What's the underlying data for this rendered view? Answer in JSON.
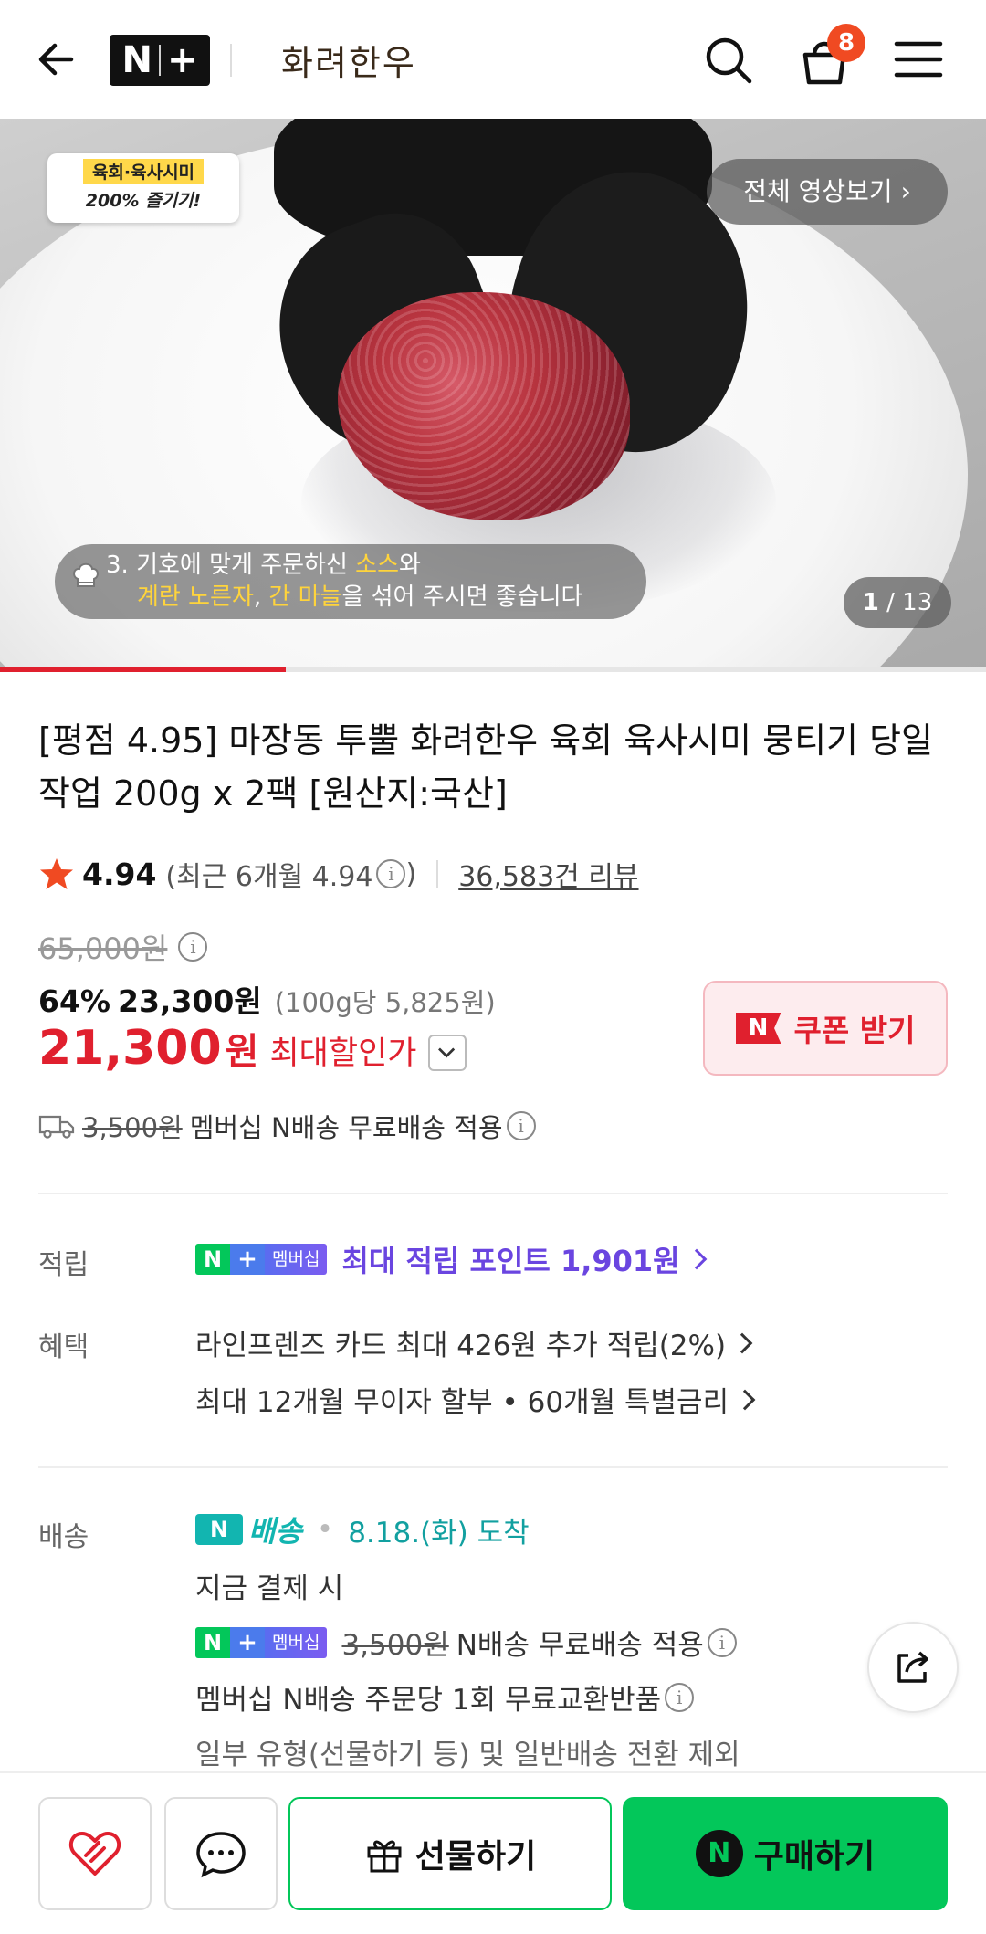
{
  "header": {
    "logo_text": "N",
    "logo_plus": "+",
    "store_name": "화려한우",
    "cart_count": "8"
  },
  "media": {
    "tag_line1": "육회·육사시미",
    "tag_line2": "200% 즐기기!",
    "full_video_label": "전체 영상보기",
    "caption_line1_prefix": "3. 기호에 맞게 주문하신 ",
    "caption_line1_highlight": "소스",
    "caption_line1_suffix": "와",
    "caption_line2_highlight1": "계란 노른자",
    "caption_line2_comma": ", ",
    "caption_line2_highlight2": "간 마늘",
    "caption_line2_suffix": "을 섞어 주시면 좋습니다",
    "counter_current": "1",
    "counter_total": "/ 13",
    "progress_fraction": 0.29
  },
  "product": {
    "title": "[평점 4.95] 마장동 투뿔 화려한우 육회 육사시미 뭉티기 당일작업 200g x 2팩 [원산지:국산]",
    "rating": "4.94",
    "recent_rating_text": "(최근 6개월 4.94",
    "recent_rating_close": ")",
    "review_count": "36,583건 리뷰",
    "original_price": "65,000원",
    "discount_percent": "64%",
    "discount_price": "23,300원",
    "unit_price": "(100g당 5,825원)",
    "final_price": "21,300",
    "final_currency": "원",
    "final_label": "최대할인가",
    "coupon_label": "쿠폰 받기",
    "coupon_n": "N",
    "shipping_fee": "3,500원",
    "shipping_text": "멤버십 N배송 무료배송 적용"
  },
  "benefits": {
    "points_label": "적립",
    "membership_badge": "멤버십",
    "points_text": "최대 적립 포인트 1,901원",
    "benefit_label": "혜택",
    "benefit_1": "라인프렌즈 카드 최대 426원 추가 적립(2%)",
    "benefit_2": "최대 12개월 무이자 할부 • 60개월 특별금리"
  },
  "delivery": {
    "label": "배송",
    "service_name": "배송",
    "date": "8.18.(화) 도착",
    "condition": "지금 결제 시",
    "fee": "3,500원",
    "fee_text": "N배송 무료배송 적용",
    "exchange_text": "멤버십 N배송 주문당 1회 무료교환반품",
    "exclusion_text": "일부 유형(선물하기 등) 및 일반배송 전환 제외"
  },
  "bottom_bar": {
    "gift_label": "선물하기",
    "buy_label": "구매하기",
    "buy_n": "N"
  },
  "colors": {
    "accent_red": "#e0202e",
    "naver_green": "#03c75a",
    "point_purple": "#6a45e0",
    "delivery_teal": "#12b5b0"
  },
  "icons": [
    "back-arrow-icon",
    "search-icon",
    "cart-icon",
    "menu-icon",
    "chef-hat-icon",
    "star-icon",
    "info-icon",
    "chevron-down-icon",
    "truck-icon",
    "chevron-right-icon",
    "share-icon",
    "heart-icon",
    "chat-icon",
    "gift-icon"
  ]
}
